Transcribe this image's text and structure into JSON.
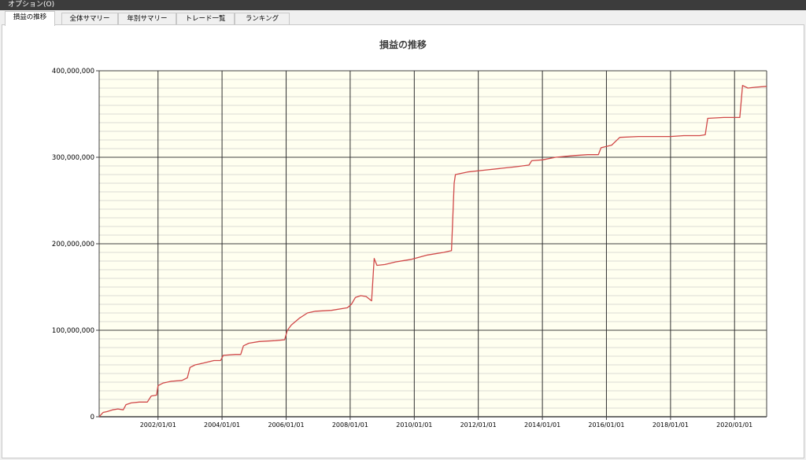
{
  "menu": {
    "label": "オプション(O)"
  },
  "tabs": [
    {
      "label": "損益の推移",
      "active": true
    },
    {
      "label": "全体サマリー",
      "active": false
    },
    {
      "label": "年別サマリー",
      "active": false
    },
    {
      "label": "トレード一覧",
      "active": false
    },
    {
      "label": "ランキング",
      "active": false
    }
  ],
  "colors": {
    "plot_background": "#fffff0",
    "line": "#d04848",
    "menubar": "#3c3c3c"
  },
  "chart_data": {
    "type": "line",
    "title": "損益の推移",
    "xlabel": "",
    "ylabel": "",
    "x_range": [
      "2000-03-01",
      "2021-01-01"
    ],
    "ylim": [
      0,
      400000000
    ],
    "y_ticks": [
      {
        "value": 0,
        "label": "0"
      },
      {
        "value": 100000000,
        "label": "100,000,000"
      },
      {
        "value": 200000000,
        "label": "200,000,000"
      },
      {
        "value": 300000000,
        "label": "300,000,000"
      },
      {
        "value": 400000000,
        "label": "400,000,000"
      }
    ],
    "x_ticks": [
      {
        "value": "2002-01-01",
        "label": "2002/01/01"
      },
      {
        "value": "2004-01-01",
        "label": "2004/01/01"
      },
      {
        "value": "2006-01-01",
        "label": "2006/01/01"
      },
      {
        "value": "2008-01-01",
        "label": "2008/01/01"
      },
      {
        "value": "2010-01-01",
        "label": "2010/01/01"
      },
      {
        "value": "2012-01-01",
        "label": "2012/01/01"
      },
      {
        "value": "2014-01-01",
        "label": "2014/01/01"
      },
      {
        "value": "2016-01-01",
        "label": "2016/01/01"
      },
      {
        "value": "2018-01-01",
        "label": "2018/01/01"
      },
      {
        "value": "2020-01-01",
        "label": "2020/01/01"
      }
    ],
    "grid": true,
    "series": [
      {
        "points": [
          [
            "2000-03-01",
            0
          ],
          [
            "2000-04-15",
            5000000
          ],
          [
            "2000-06-01",
            6000000
          ],
          [
            "2000-08-01",
            8000000
          ],
          [
            "2000-10-01",
            9000000
          ],
          [
            "2000-12-01",
            8000000
          ],
          [
            "2001-01-01",
            14000000
          ],
          [
            "2001-03-01",
            16000000
          ],
          [
            "2001-06-01",
            17000000
          ],
          [
            "2001-09-01",
            17000000
          ],
          [
            "2001-10-15",
            24000000
          ],
          [
            "2001-12-15",
            25000000
          ],
          [
            "2002-01-01",
            36000000
          ],
          [
            "2002-03-01",
            39000000
          ],
          [
            "2002-06-01",
            41000000
          ],
          [
            "2002-10-01",
            42000000
          ],
          [
            "2002-12-01",
            45000000
          ],
          [
            "2003-01-01",
            57000000
          ],
          [
            "2003-03-01",
            60000000
          ],
          [
            "2003-06-01",
            62000000
          ],
          [
            "2003-10-01",
            65000000
          ],
          [
            "2003-12-15",
            65000000
          ],
          [
            "2004-01-15",
            71000000
          ],
          [
            "2004-06-01",
            72000000
          ],
          [
            "2004-08-01",
            72000000
          ],
          [
            "2004-09-01",
            82000000
          ],
          [
            "2004-11-01",
            85000000
          ],
          [
            "2005-03-01",
            87000000
          ],
          [
            "2005-09-01",
            88000000
          ],
          [
            "2005-12-15",
            89000000
          ],
          [
            "2006-01-15",
            100000000
          ],
          [
            "2006-03-01",
            106000000
          ],
          [
            "2006-06-01",
            114000000
          ],
          [
            "2006-09-01",
            120000000
          ],
          [
            "2006-12-01",
            122000000
          ],
          [
            "2007-06-01",
            123000000
          ],
          [
            "2007-12-01",
            126000000
          ],
          [
            "2008-01-15",
            130000000
          ],
          [
            "2008-03-01",
            138000000
          ],
          [
            "2008-05-01",
            140000000
          ],
          [
            "2008-07-01",
            139000000
          ],
          [
            "2008-09-01",
            134000000
          ],
          [
            "2008-10-01",
            183000000
          ],
          [
            "2008-11-01",
            175000000
          ],
          [
            "2009-02-01",
            176000000
          ],
          [
            "2009-06-01",
            179000000
          ],
          [
            "2009-12-01",
            182000000
          ],
          [
            "2010-06-01",
            187000000
          ],
          [
            "2010-12-01",
            190000000
          ],
          [
            "2011-03-01",
            192000000
          ],
          [
            "2011-04-01",
            270000000
          ],
          [
            "2011-04-15",
            280000000
          ],
          [
            "2011-09-01",
            283000000
          ],
          [
            "2012-03-01",
            285000000
          ],
          [
            "2012-09-01",
            287000000
          ],
          [
            "2013-03-01",
            289000000
          ],
          [
            "2013-08-01",
            291000000
          ],
          [
            "2013-09-01",
            296000000
          ],
          [
            "2014-01-01",
            297000000
          ],
          [
            "2014-06-01",
            300000000
          ],
          [
            "2015-01-01",
            302000000
          ],
          [
            "2015-06-01",
            303000000
          ],
          [
            "2015-10-01",
            303000000
          ],
          [
            "2015-11-01",
            311000000
          ],
          [
            "2016-03-01",
            314000000
          ],
          [
            "2016-06-01",
            323000000
          ],
          [
            "2017-01-01",
            324000000
          ],
          [
            "2018-01-01",
            324000000
          ],
          [
            "2018-06-01",
            325000000
          ],
          [
            "2018-12-01",
            325000000
          ],
          [
            "2019-02-01",
            326000000
          ],
          [
            "2019-03-01",
            345000000
          ],
          [
            "2019-09-01",
            346000000
          ],
          [
            "2020-03-01",
            346000000
          ],
          [
            "2020-04-01",
            383000000
          ],
          [
            "2020-06-01",
            380000000
          ],
          [
            "2020-09-01",
            381000000
          ],
          [
            "2021-01-01",
            382000000
          ]
        ]
      }
    ]
  }
}
